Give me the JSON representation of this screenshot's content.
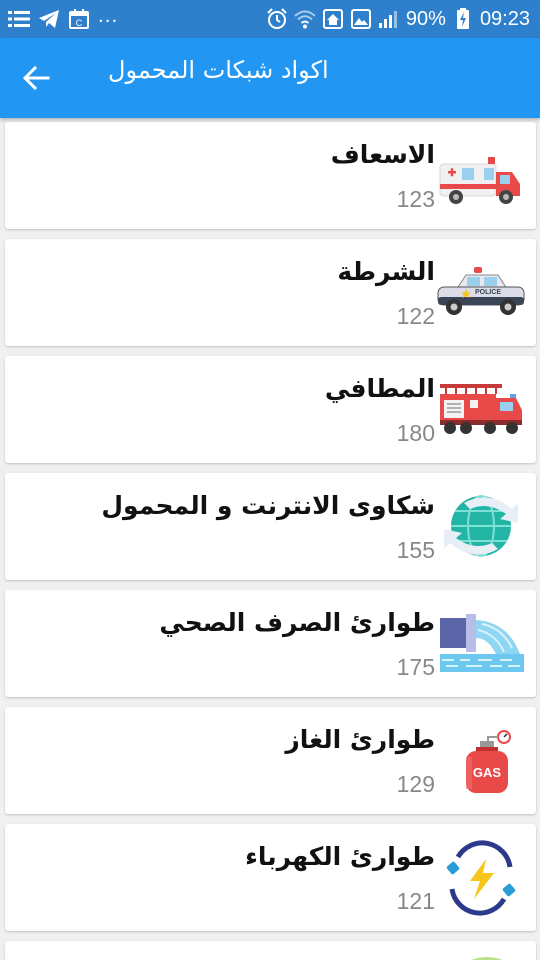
{
  "status_bar": {
    "battery_percent": "90%",
    "time": "09:23",
    "overflow": "..."
  },
  "app_bar": {
    "title": "اكواد شبكات المحمول"
  },
  "items": [
    {
      "name": "الاسعاف",
      "code": "123",
      "icon": "ambulance-icon"
    },
    {
      "name": "الشرطة",
      "code": "122",
      "icon": "police-car-icon"
    },
    {
      "name": "المطافي",
      "code": "180",
      "icon": "fire-truck-icon"
    },
    {
      "name": "شكاوى الانترنت و المحمول",
      "code": "155",
      "icon": "globe-sync-icon"
    },
    {
      "name": "طوارئ الصرف الصحي",
      "code": "175",
      "icon": "sewer-pipe-icon"
    },
    {
      "name": "طوارئ الغاز",
      "code": "129",
      "icon": "gas-cylinder-icon"
    },
    {
      "name": "طوارئ الكهرباء",
      "code": "121",
      "icon": "electricity-icon"
    }
  ],
  "colors": {
    "status_bar": "#2e80cc",
    "app_bar": "#2196f3",
    "background": "#f0f0f0",
    "code_text": "#888888"
  }
}
